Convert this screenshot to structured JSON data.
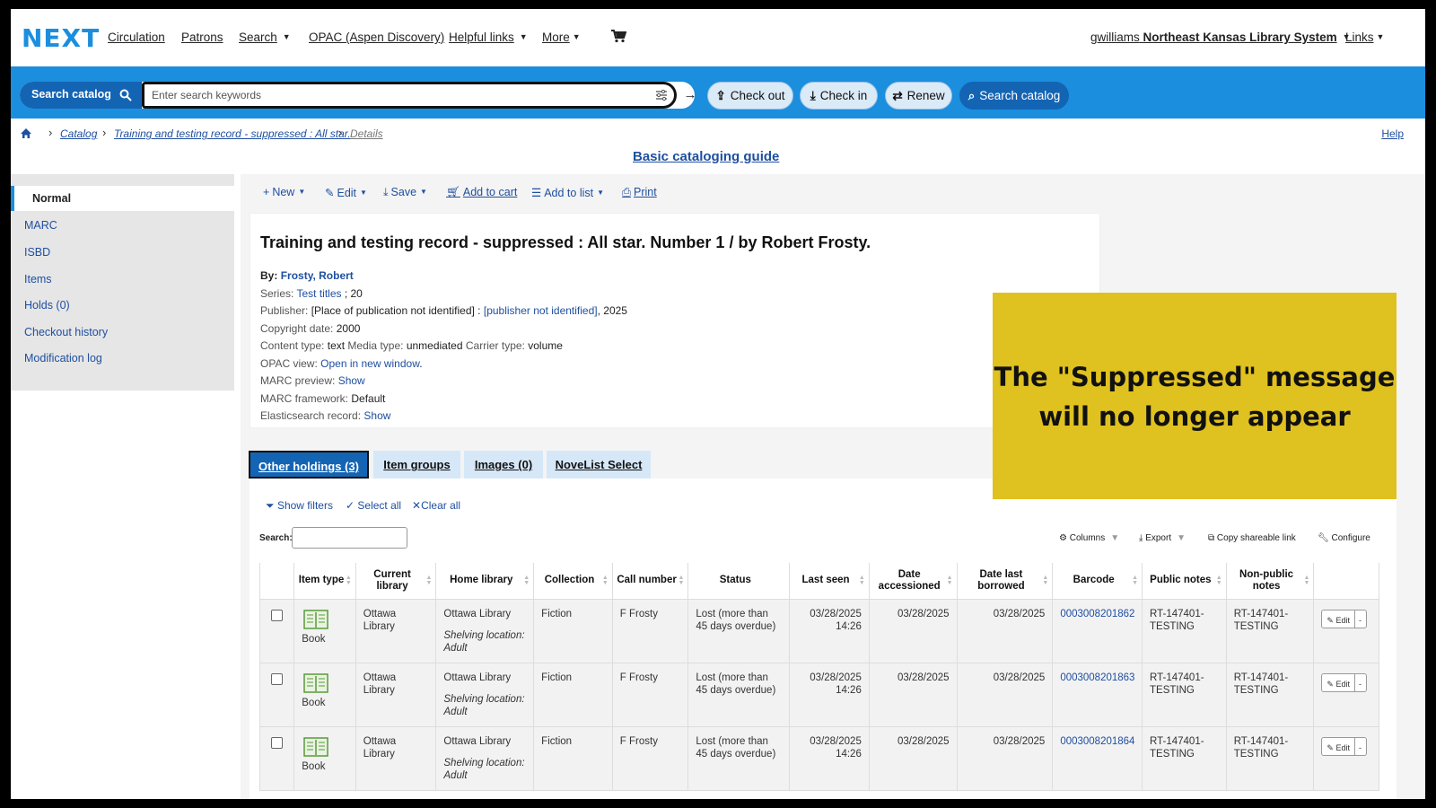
{
  "nav": {
    "logo": "NEXT",
    "items": [
      "Circulation",
      "Patrons",
      "Search",
      "OPAC (Aspen Discovery)",
      "Helpful links",
      "More"
    ],
    "user": "gwilliams",
    "library": "Northeast Kansas Library System",
    "links": "Links"
  },
  "searchbar": {
    "type_label": "Search catalog",
    "placeholder": "Enter search keywords",
    "buttons": {
      "checkout": "Check out",
      "checkin": "Check in",
      "renew": "Renew",
      "search_catalog": "Search catalog"
    }
  },
  "breadcrumb": {
    "items": [
      "Catalog",
      "Training and testing record - suppressed : All star.",
      "Details"
    ],
    "help": "Help"
  },
  "guide_link": "Basic cataloging guide",
  "sidebar": {
    "active": "Normal",
    "items": [
      "MARC",
      "ISBD",
      "Items",
      "Holds (0)",
      "Checkout history",
      "Modification log"
    ]
  },
  "toolbar": {
    "new": "New",
    "edit": "Edit",
    "save": "Save",
    "add_to_cart": "Add to cart",
    "add_to_list": "Add to list",
    "print": "Print"
  },
  "record": {
    "title": "Training and testing record - suppressed : All star. Number 1 / by Robert Frosty.",
    "by_label": "By:",
    "author": "Frosty, Robert",
    "series_label": "Series:",
    "series": "Test titles",
    "series_num": "; 20",
    "publisher_label": "Publisher:",
    "publisher_place": "[Place of publication not identified] :",
    "publisher_link": "[publisher not identified]",
    "publisher_year": ", 2025",
    "copyright_label": "Copyright date:",
    "copyright": "2000",
    "content_label": "Content type:",
    "content": "text",
    "media_label": "Media type:",
    "media": "unmediated",
    "carrier_label": "Carrier type:",
    "carrier": "volume",
    "opac_label": "OPAC view:",
    "opac_link": "Open in new window",
    "opac_end": ".",
    "marc_label": "MARC preview:",
    "marc_link": "Show",
    "framework_label": "MARC framework:",
    "framework": "Default",
    "elastic_label": "Elasticsearch record:",
    "elastic_link": "Show"
  },
  "callout": {
    "line1": "The \"Suppressed\" message",
    "line2": "will no longer appear",
    "color": "#dfc11f"
  },
  "tabs": [
    "Other holdings (3)",
    "Item groups",
    "Images (0)",
    "NoveList Select"
  ],
  "holdings": {
    "show_filters": "Show filters",
    "select_all": "Select all",
    "clear_all": "Clear all",
    "search_label": "Search:",
    "columns": "Columns",
    "export": "Export",
    "copy_link": "Copy shareable link",
    "configure": "Configure",
    "headers": [
      "Item type",
      "Current library",
      "Home library",
      "Collection",
      "Call number",
      "Status",
      "Last seen",
      "Date accessioned",
      "Date last borrowed",
      "Barcode",
      "Public notes",
      "Non-public notes"
    ],
    "rows": [
      {
        "item_type": "Book",
        "current": "Ottawa Library",
        "home": "Ottawa Library",
        "shelf": "Shelving location: Adult",
        "collection": "Fiction",
        "call": "F Frosty",
        "status": "Lost (more than 45 days overdue)",
        "last_seen": "03/28/2025 14:26",
        "accessioned": "03/28/2025",
        "borrowed": "03/28/2025",
        "barcode": "0003008201862",
        "public": "RT-147401-TESTING",
        "nonpublic": "RT-147401-TESTING",
        "edit": "Edit",
        "more": "-"
      },
      {
        "item_type": "Book",
        "current": "Ottawa Library",
        "home": "Ottawa Library",
        "shelf": "Shelving location: Adult",
        "collection": "Fiction",
        "call": "F Frosty",
        "status": "Lost (more than 45 days overdue)",
        "last_seen": "03/28/2025 14:26",
        "accessioned": "03/28/2025",
        "borrowed": "03/28/2025",
        "barcode": "0003008201863",
        "public": "RT-147401-TESTING",
        "nonpublic": "RT-147401-TESTING",
        "edit": "Edit",
        "more": "-"
      },
      {
        "item_type": "Book",
        "current": "Ottawa Library",
        "home": "Ottawa Library",
        "shelf": "Shelving location: Adult",
        "collection": "Fiction",
        "call": "F Frosty",
        "status": "Lost (more than 45 days overdue)",
        "last_seen": "03/28/2025 14:26",
        "accessioned": "03/28/2025",
        "borrowed": "03/28/2025",
        "barcode": "0003008201864",
        "public": "RT-147401-TESTING",
        "nonpublic": "RT-147401-TESTING",
        "edit": "Edit",
        "more": "-"
      }
    ]
  }
}
